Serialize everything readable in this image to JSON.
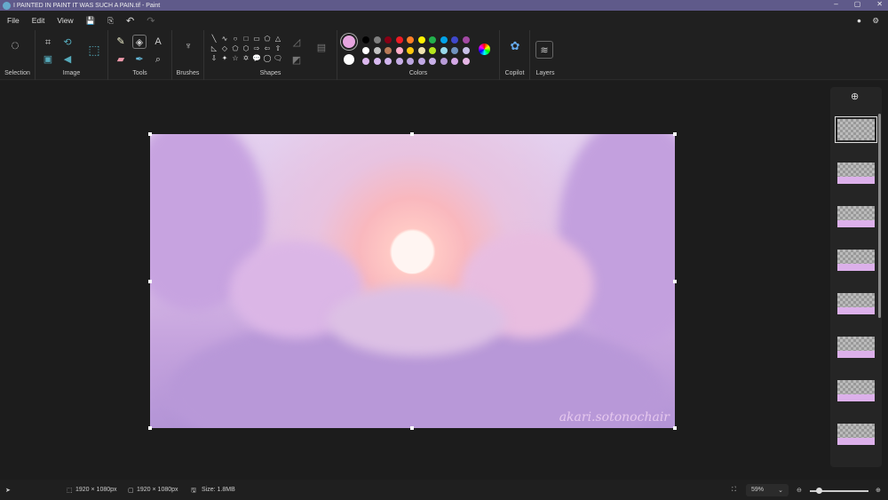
{
  "window": {
    "title": "I PAINTED IN PAINT IT WAS SUCH A PAIN.tif - Paint",
    "min": "–",
    "max": "▢",
    "close": "✕"
  },
  "menu": [
    "File",
    "Edit",
    "View"
  ],
  "ribbon": {
    "groups": [
      "Selection",
      "Image",
      "Tools",
      "Brushes",
      "Shapes",
      "Colors",
      "Copilot",
      "Layers"
    ],
    "shapes": [
      "╲",
      "∿",
      "○",
      "□",
      "▭",
      "⬠",
      "△",
      "◺",
      "◇",
      "⬠",
      "⬡",
      "⇨",
      "⇦",
      "⇧",
      "⇩",
      "✦",
      "☆",
      "✡",
      "💬",
      "◯",
      "🗨"
    ]
  },
  "colors": {
    "primary": "#e7a6e0",
    "secondary": "#ffffff",
    "palette": [
      "#000000",
      "#7f7f7f",
      "#880015",
      "#ed1c24",
      "#ff7f27",
      "#fff200",
      "#22b14c",
      "#00a2e8",
      "#3f48cc",
      "#a349a4",
      "#ffffff",
      "#c3c3c3",
      "#b97a57",
      "#ffaec9",
      "#ffc90e",
      "#efe4b0",
      "#b5e61d",
      "#99d9ea",
      "#7092be",
      "#c8bfe7",
      "#dcb8ee",
      "#d8baf0",
      "#d2b6ee",
      "#c7aee6",
      "#bca6e0",
      "#c0a8e4",
      "#c8b0e8",
      "#b89cd8",
      "#d4a8e6",
      "#e6b6e6"
    ]
  },
  "canvas": {
    "signature": "akari.sotonochair"
  },
  "layers": {
    "count": 8
  },
  "status": {
    "selection_size": "1920 × 1080px",
    "canvas_size": "1920 × 1080px",
    "file_size": "Size: 1.8MB",
    "zoom": "59%",
    "zoom_level": 0.1
  }
}
